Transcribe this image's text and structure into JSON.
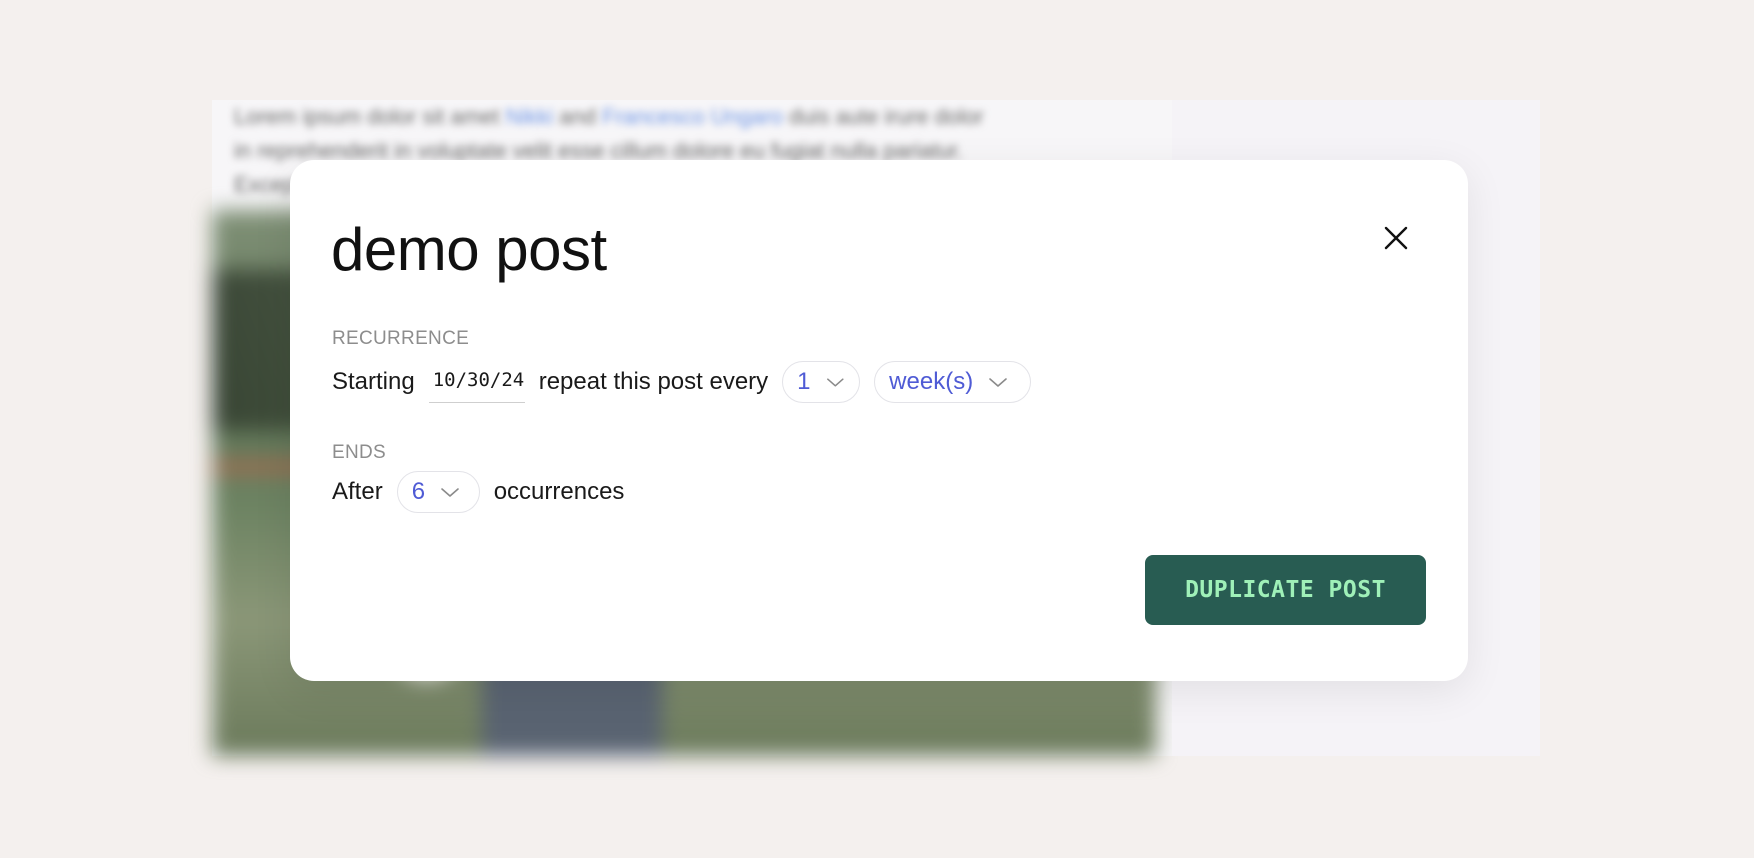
{
  "background": {
    "text_line_1_pre": "Lorem ipsum dolor sit amet ",
    "text_link_1": "Nikki",
    "text_line_1_mid": " and ",
    "text_link_2": "Francesco Ungaro",
    "text_line_1_post": " duis aute irure dolor",
    "text_line_2": "in reprehenderit in voluptate velit esse cillum dolore eu fugiat nulla pariatur.",
    "text_line_3": "Excepteur"
  },
  "modal": {
    "title": "demo post",
    "recurrence": {
      "label": "RECURRENCE",
      "starting_text": "Starting",
      "start_date": "10/30/24",
      "repeat_text": "repeat this post every",
      "interval_value": "1",
      "unit_value": "week(s)"
    },
    "ends": {
      "label": "ENDS",
      "after_text": "After",
      "occurrences_value": "6",
      "occurrences_text": "occurrences"
    },
    "primary_button_label": "DUPLICATE POST"
  },
  "colors": {
    "accent": "#4f5bd5",
    "button_bg": "#285c52",
    "button_text": "#9ff0b8"
  },
  "icons": {
    "close": "close-icon",
    "chevron": "chevron-down-icon"
  }
}
